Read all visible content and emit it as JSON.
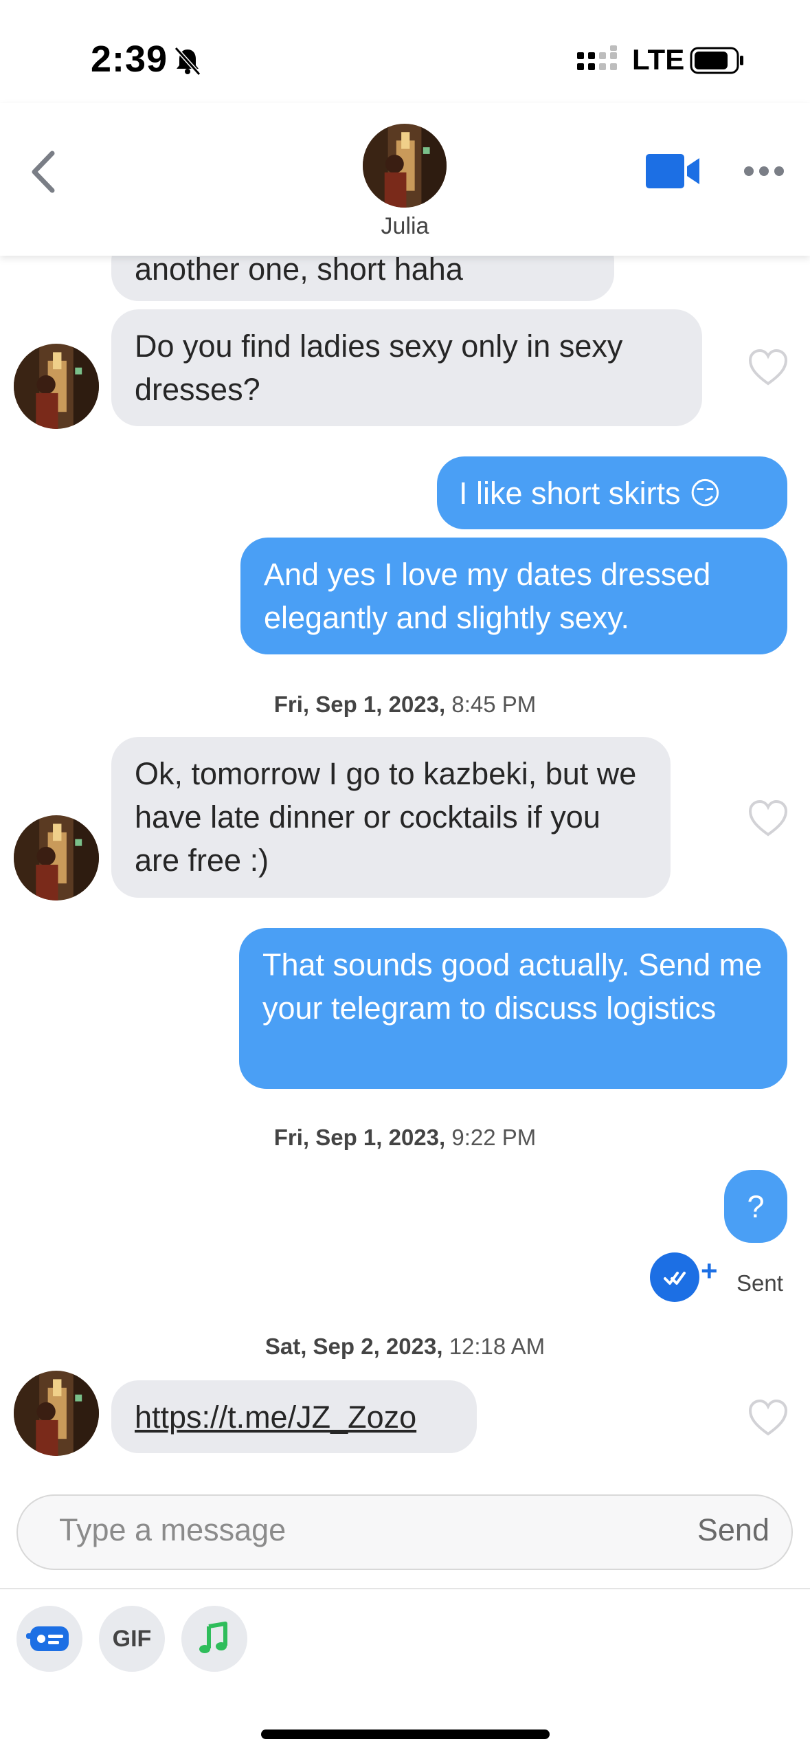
{
  "status_bar": {
    "time": "2:39",
    "network": "LTE"
  },
  "header": {
    "contact_name": "Julia"
  },
  "messages": [
    {
      "from": "them",
      "text": "another one, short haha"
    },
    {
      "from": "them",
      "text": "Do you find ladies sexy only in sexy dresses?"
    },
    {
      "from": "me",
      "text": "I like short skirts 😏"
    },
    {
      "from": "me",
      "text": "And yes I love my dates dressed elegantly and slightly sexy."
    },
    {
      "timestamp_date": "Fri, Sep 1, 2023,",
      "timestamp_time": "8:45 PM"
    },
    {
      "from": "them",
      "text": "Ok, tomorrow I go to kazbeki, but we have late dinner or cocktails if you are free :)"
    },
    {
      "from": "me",
      "text": "That sounds good actually. Send me your telegram to discuss logistics"
    },
    {
      "timestamp_date": "Fri, Sep 1, 2023,",
      "timestamp_time": "9:22 PM"
    },
    {
      "from": "me",
      "text": "?"
    },
    {
      "timestamp_date": "Sat, Sep 2, 2023,",
      "timestamp_time": "12:18 AM"
    },
    {
      "from": "them",
      "text": "https://t.me/JZ_Zozo"
    }
  ],
  "delivery": {
    "status": "Sent",
    "plus": "+"
  },
  "composer": {
    "placeholder": "Type a message",
    "send_label": "Send"
  },
  "toolbar": {
    "gif_label": "GIF"
  },
  "colors": {
    "outgoing_bubble": "#4a9ff5",
    "incoming_bubble": "#e9eaee",
    "accent": "#1c6fe4",
    "music_icon": "#2fbd5b"
  },
  "icons": [
    "back-chevron-icon",
    "video-call-icon",
    "more-icon",
    "heart-icon",
    "double-check-icon",
    "card-icon",
    "music-note-icon",
    "bell-muted-icon"
  ]
}
